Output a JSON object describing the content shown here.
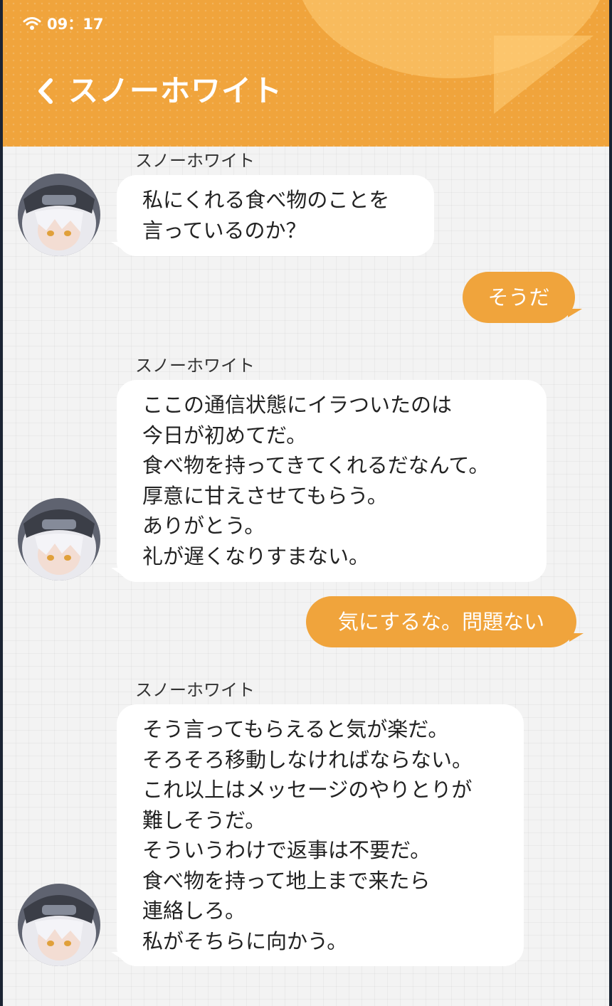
{
  "status_bar": {
    "time": "09：17",
    "wifi_icon": "wifi-icon"
  },
  "header": {
    "back_icon": "chevron-left-icon",
    "title": "スノーホワイト"
  },
  "colors": {
    "accent": "#f0a43c",
    "incoming_bubble": "#ffffff",
    "background": "#f3f3f3"
  },
  "messages": [
    {
      "direction": "incoming",
      "sender": "スノーホワイト",
      "text": "私にくれる食べ物のことを\n言っているのか？"
    },
    {
      "direction": "outgoing",
      "text": "そうだ"
    },
    {
      "direction": "incoming",
      "sender": "スノーホワイト",
      "text": "ここの通信状態にイラついたのは\n今日が初めてだ。\n食べ物を持ってきてくれるだなんて。\n厚意に甘えさせてもらう。\nありがとう。\n礼が遅くなりすまない。"
    },
    {
      "direction": "outgoing",
      "text": "気にするな。問題ない"
    },
    {
      "direction": "incoming",
      "sender": "スノーホワイト",
      "text": "そう言ってもらえると気が楽だ。\nそろそろ移動しなければならない。\nこれ以上はメッセージのやりとりが\n難しそうだ。\nそういうわけで返事は不要だ。\n食べ物を持って地上まで来たら\n連絡しろ。\n私がそちらに向かう。"
    }
  ]
}
